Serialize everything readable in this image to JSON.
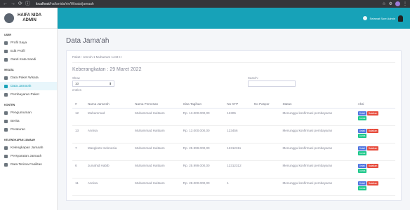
{
  "browser": {
    "url_host": "localhost",
    "url_path": "/haifanida/rin/Wisata/jamaah",
    "nav_icons": [
      "back-icon",
      "forward-icon",
      "reload-icon",
      "info-icon"
    ]
  },
  "brand": {
    "line1": "HAIFA NIDA",
    "line2": "ADMIN"
  },
  "sidebar": {
    "sections": [
      {
        "title": "USER",
        "items": [
          {
            "label": "Profil Saya",
            "icon": "user-icon"
          },
          {
            "label": "Edit Profil",
            "icon": "user-edit-icon"
          },
          {
            "label": "Ganti Kata Sandi",
            "icon": "key-icon"
          }
        ]
      },
      {
        "title": "WISATA",
        "items": [
          {
            "label": "Data Paket Wisata",
            "icon": "box-icon"
          },
          {
            "label": "Data Jama'ah",
            "icon": "users-icon",
            "active": true
          },
          {
            "label": "Pembayaran Paket",
            "icon": "money-icon"
          }
        ]
      },
      {
        "title": "KONTEN",
        "items": [
          {
            "label": "Pengumuman",
            "icon": "megaphone-icon"
          },
          {
            "label": "Berita",
            "icon": "news-icon"
          },
          {
            "label": "Peraturan",
            "icon": "rules-icon"
          }
        ]
      },
      {
        "title": "KELENGKAPAN JAMAAH",
        "items": [
          {
            "label": "Kelengkapan Jamaah",
            "icon": "list-icon"
          },
          {
            "label": "Persyaratan Jamaah",
            "icon": "file-icon"
          },
          {
            "label": "Data Terima Fasilitas",
            "icon": "check-icon"
          }
        ]
      }
    ]
  },
  "topbar": {
    "greeting": "Selamat Sore Admin",
    "colors": {
      "accent": "#17a2b8"
    }
  },
  "page": {
    "title": "Data Jama'ah",
    "paket": "Paket : Umroh 1 Muharram 1443 H",
    "keberangkatan": "Keberangkatan : 29 Maret 2022",
    "show_label": "Show",
    "show_value": "10",
    "entries_label": "entries",
    "search_label": "Search:"
  },
  "table": {
    "headers": [
      "#",
      "Nama Jama'ah",
      "Nama Pemesan",
      "Sisa Tagihan",
      "No KTP",
      "No Paspor",
      "Status",
      "Aksi"
    ],
    "rows": [
      {
        "no": "12",
        "nama": "Muhammad",
        "pemesan": "Muhammad Haitsam",
        "sisa": "Rp. 13.000.000,00",
        "ktp": "12305",
        "paspor": "",
        "status": "Menunggu konfirmasi pembayaran"
      },
      {
        "no": "13",
        "nama": "Annisa",
        "pemesan": "Muhammad Haitsam",
        "sisa": "Rp. 13.000.000,00",
        "ktp": "123456",
        "paspor": "",
        "status": "Menunggu konfirmasi pembayaran"
      },
      {
        "no": "7",
        "nama": "Mangkoto Indonesia",
        "pemesan": "Muhammad Haitsam",
        "sisa": "Rp. 25.999.000,00",
        "ktp": "12312311",
        "paspor": "",
        "status": "Menunggu konfirmasi pembayaran"
      },
      {
        "no": "6",
        "nama": "Jumahid Habib",
        "pemesan": "Muhammad Haitsam",
        "sisa": "Rp. 25.999.000,00",
        "ktp": "12312312",
        "paspor": "",
        "status": "Menunggu konfirmasi pembayaran"
      },
      {
        "no": "11",
        "nama": "Annisa",
        "pemesan": "Muhammad Haitsam",
        "sisa": "Rp. 28.000.000,00",
        "ktp": "1",
        "paspor": "",
        "status": "Menunggu konfirmasi pembayaran"
      }
    ],
    "action_labels": {
      "detail": "Detail",
      "delete": "Batalkan",
      "lunas": "Lunas"
    }
  }
}
